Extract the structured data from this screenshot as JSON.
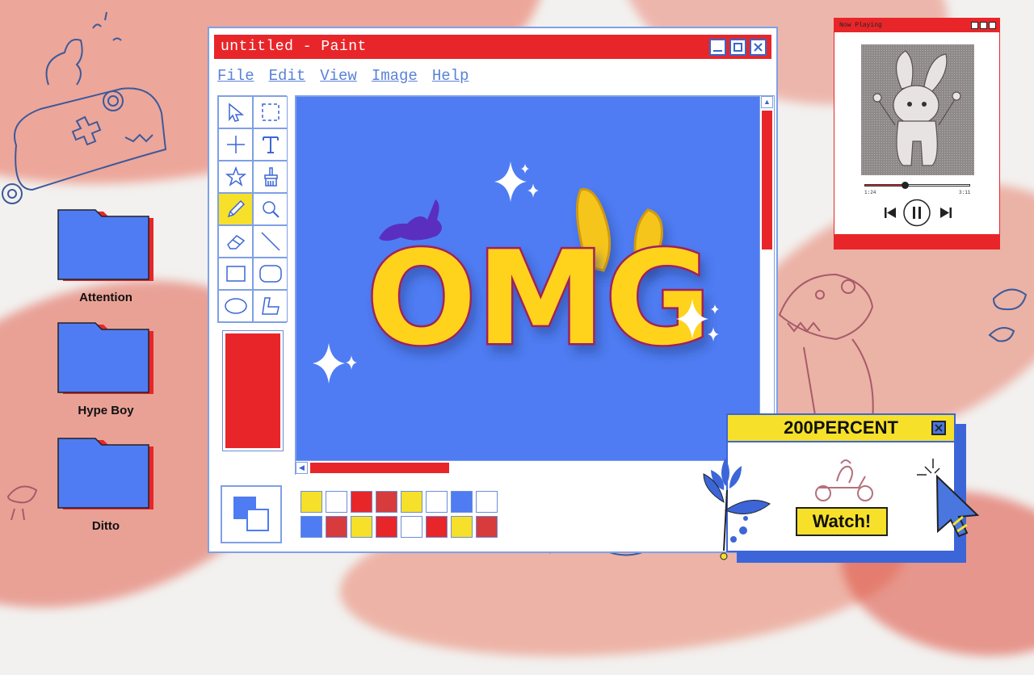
{
  "desktop": {
    "folders": [
      {
        "label": "Attention"
      },
      {
        "label": "Hype Boy"
      },
      {
        "label": "Ditto"
      }
    ]
  },
  "paint": {
    "title": "untitled - Paint",
    "menu": [
      "File",
      "Edit",
      "View",
      "Image",
      "Help"
    ],
    "tools": [
      "select-free-icon",
      "select-rect-icon",
      "crosshair-icon",
      "text-icon",
      "star-icon",
      "brush-icon",
      "pencil-icon",
      "magnifier-icon",
      "eraser-icon",
      "line-icon",
      "rectangle-icon",
      "rounded-rect-icon",
      "ellipse-icon",
      "polygon-icon"
    ],
    "active_tool": "pencil-icon",
    "current_color": "#e8262a",
    "palette": [
      "#f6e02a",
      "#ffffff",
      "#e8262a",
      "#d83b3b",
      "#f6e02a",
      "#ffffff",
      "#4f7cf2",
      "#ffffff",
      "#4f7cf2",
      "#d83b3b",
      "#f6e02a",
      "#e8262a",
      "#ffffff",
      "#e8262a",
      "#f6e02a",
      "#d83b3b"
    ],
    "canvas_text": "OMG"
  },
  "player": {
    "title": "Now Playing",
    "elapsed": "1:24",
    "duration": "3:11",
    "progress": 0.38
  },
  "popup": {
    "title": "200PERCENT",
    "button": "Watch!"
  },
  "colors": {
    "accent_red": "#e8262a",
    "accent_blue": "#4f7cf2",
    "accent_yellow": "#f6e02a"
  }
}
